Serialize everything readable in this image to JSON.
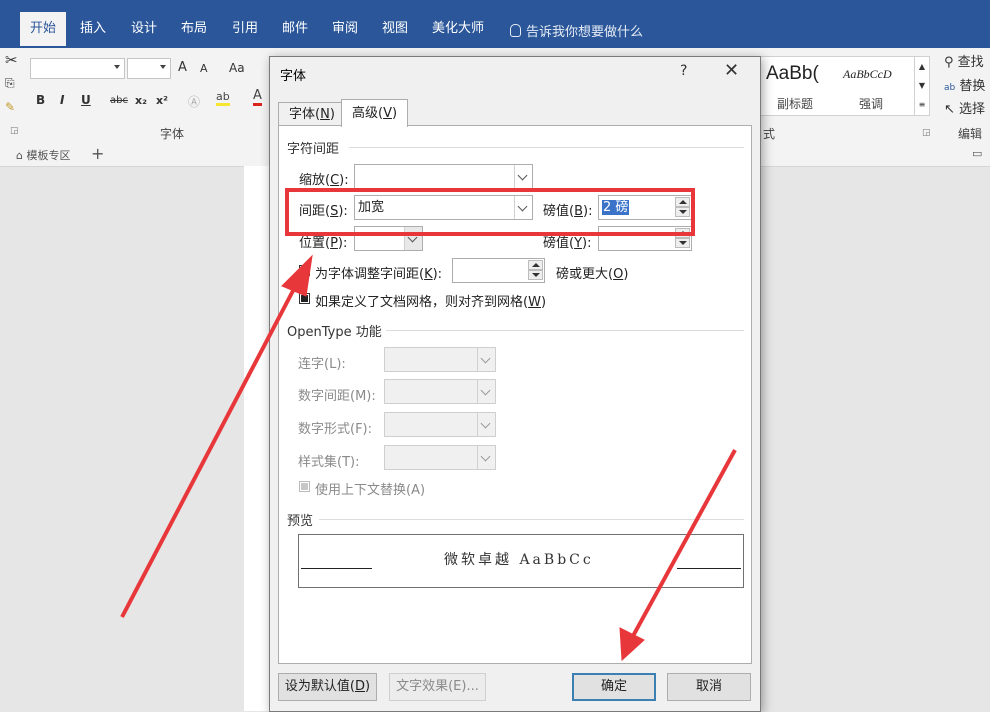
{
  "ribbon": {
    "tabs": [
      "开始",
      "插入",
      "设计",
      "布局",
      "引用",
      "邮件",
      "审阅",
      "视图",
      "美化大师"
    ],
    "tell_me": "告诉我你想要做什么",
    "font_group_label": "字体",
    "styles_group_label": "式",
    "editing_group_label": "编辑",
    "font_grow": "A",
    "font_shrink": "A",
    "change_case": "Aa",
    "format_buttons": [
      "B",
      "I",
      "U",
      "abc",
      "x₂",
      "x²"
    ],
    "style_samples": [
      {
        "sample": "AaBb(",
        "name": "副标题"
      },
      {
        "sample": "AaBbCcD",
        "name": "强调"
      }
    ],
    "editing": [
      "查找",
      "替换",
      "选择"
    ],
    "doc_tab": "模板专区",
    "add_tab": "+"
  },
  "dialog": {
    "title": "字体",
    "help": "?",
    "close": "✕",
    "tabs": [
      {
        "label_pre": "字体(",
        "key": "N",
        "label_post": ")",
        "active": false
      },
      {
        "label_pre": "高级(",
        "key": "V",
        "label_post": ")",
        "active": true
      }
    ],
    "char_spacing": {
      "section": "字符间距",
      "scale": {
        "label_pre": "缩放(",
        "key": "C",
        "label_post": "):",
        "value": ""
      },
      "spacing": {
        "label_pre": "间距(",
        "key": "S",
        "label_post": "):",
        "value": "加宽"
      },
      "spacing_by": {
        "label_pre": "磅值(",
        "key": "B",
        "label_post": "):",
        "value": "2 磅"
      },
      "position": {
        "label_pre": "位置(",
        "key": "P",
        "label_post": "):",
        "value": ""
      },
      "position_by": {
        "label_pre": "磅值(",
        "key": "Y",
        "label_post": "):",
        "value": ""
      },
      "kerning": {
        "label_pre": "为字体调整字间距(",
        "key": "K",
        "label_post": "):",
        "value": "",
        "suffix_pre": "磅或更大(",
        "suffix_key": "O",
        "suffix_post": ")"
      },
      "snap_grid": {
        "label_pre": "如果定义了文档网格，则对齐到网格(",
        "key": "W",
        "label_post": ")"
      }
    },
    "opentype": {
      "section": "OpenType 功能",
      "ligatures": "连字(L):",
      "number_spacing": "数字间距(M):",
      "number_forms": "数字形式(F):",
      "stylistic_sets": "样式集(T):",
      "contextual": "使用上下文替换(A)"
    },
    "preview": {
      "section": "预览",
      "text": "微软卓越  AaBbCc"
    },
    "buttons": {
      "set_default_pre": "设为默认值(",
      "set_default_key": "D",
      "set_default_post": ")",
      "text_effects": "文字效果(E)...",
      "ok": "确定",
      "cancel": "取消"
    }
  },
  "annotation_color": "#e8373a",
  "ribbon_color": "#2b579a"
}
